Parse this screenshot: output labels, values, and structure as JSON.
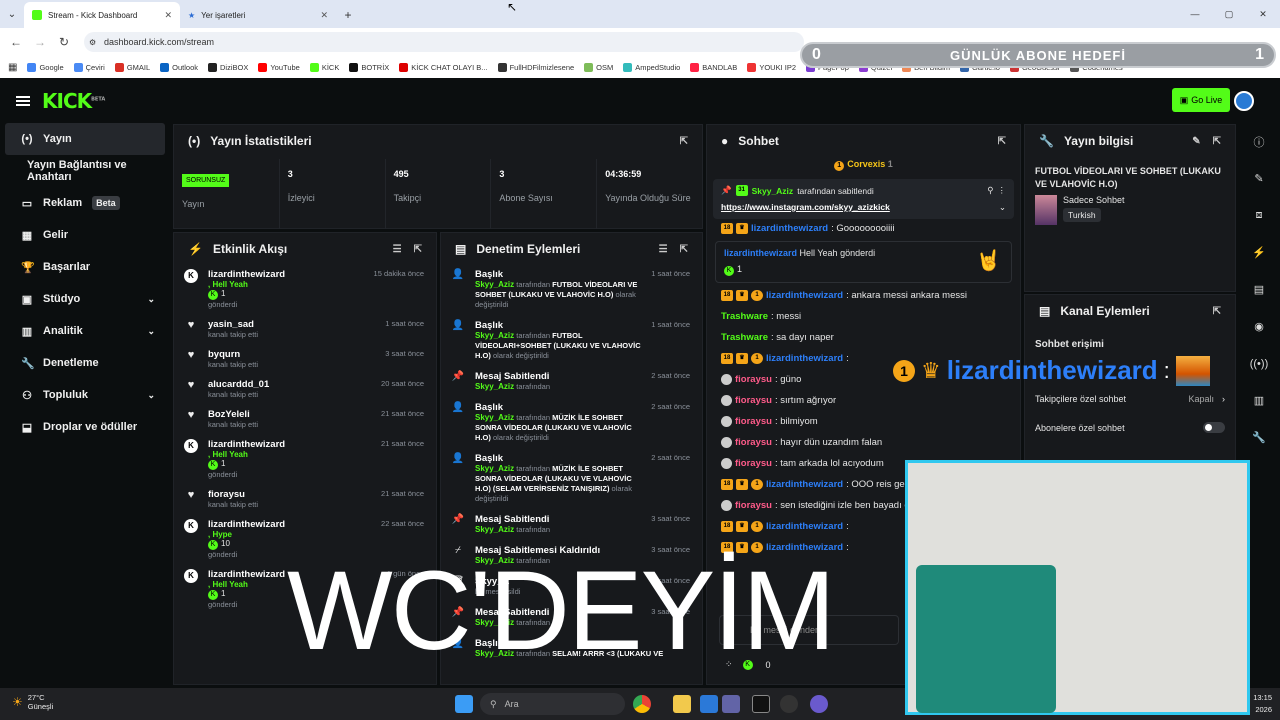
{
  "browser": {
    "tabs": [
      {
        "title": "Stream - Kick Dashboard",
        "active": true
      },
      {
        "title": "Yer işaretleri",
        "active": false
      }
    ],
    "url": "dashboard.kick.com/stream",
    "bookmarks": [
      "Google",
      "Çeviri",
      "GMAIL",
      "Outlook",
      "DiziBOX",
      "YouTube",
      "KİCK",
      "BOTRİX",
      "KİCK CHAT OLAYI B...",
      "FullHDFilmizlesene",
      "OSM",
      "AmpedStudio",
      "BANDLAB",
      "YOUKI IP2",
      "PagePop",
      "Quizei",
      "Ben Bildim",
      "Gartic.io",
      "GeoGuessr",
      "Codenames"
    ]
  },
  "goal": {
    "start": "0",
    "title": "GÜNLÜK ABONE HEDEFİ",
    "end": "1"
  },
  "header": {
    "logo": "KICK",
    "logo_sup": "BETA",
    "go_live": "Go Live"
  },
  "sidebar": {
    "items": [
      {
        "label": "Yayın",
        "icon": "broadcast-icon",
        "active": true
      },
      {
        "label": "Yayın Bağlantısı ve Anahtarı",
        "sub": true
      },
      {
        "label": "Reklam",
        "badge": "Beta",
        "icon": "ad-icon"
      },
      {
        "label": "Gelir",
        "icon": "revenue-icon"
      },
      {
        "label": "Başarılar",
        "icon": "trophy-icon"
      },
      {
        "label": "Stüdyo",
        "icon": "studio-icon",
        "chevron": true
      },
      {
        "label": "Analitik",
        "icon": "analytics-icon",
        "chevron": true
      },
      {
        "label": "Denetleme",
        "icon": "wrench-icon"
      },
      {
        "label": "Topluluk",
        "icon": "community-icon",
        "chevron": true
      },
      {
        "label": "Droplar ve ödüller",
        "icon": "drops-icon"
      }
    ]
  },
  "stats": {
    "title": "Yayın İstatistikleri",
    "status": "SORUNSUZ",
    "status_label": "Yayın",
    "items": [
      {
        "value": "3",
        "label": "İzleyici"
      },
      {
        "value": "495",
        "label": "Takipçi"
      },
      {
        "value": "3",
        "label": "Abone Sayısı"
      },
      {
        "value": "04:36:59",
        "label": "Yayında Olduğu Süre"
      }
    ]
  },
  "activity": {
    "title": "Etkinlik Akışı",
    "events": [
      {
        "user": "lizardinthewizard",
        "gift": ", Hell Yeah",
        "count": "1",
        "action": "gönderdi",
        "time": "15 dakika önce",
        "type": "kick"
      },
      {
        "user": "yasin_sad",
        "action": "kanalı takip etti",
        "time": "1 saat önce",
        "type": "follow"
      },
      {
        "user": "byqurn",
        "action": "kanalı takip etti",
        "time": "3 saat önce",
        "type": "follow"
      },
      {
        "user": "alucarddd_01",
        "action": "kanalı takip etti",
        "time": "20 saat önce",
        "type": "follow"
      },
      {
        "user": "BozYeleli",
        "action": "kanalı takip etti",
        "time": "21 saat önce",
        "type": "follow"
      },
      {
        "user": "lizardinthewizard",
        "gift": ", Hell Yeah",
        "count": "1",
        "action": "gönderdi",
        "time": "21 saat önce",
        "type": "kick"
      },
      {
        "user": "fioraysu",
        "action": "kanalı takip etti",
        "time": "21 saat önce",
        "type": "follow"
      },
      {
        "user": "lizardinthewizard",
        "gift": ", Hype",
        "count": "10",
        "action": "gönderdi",
        "time": "22 saat önce",
        "type": "kick"
      },
      {
        "user": "lizardinthewizard",
        "gift": ", Hell Yeah",
        "count": "1",
        "action": "gönderdi",
        "time": "1 gün önce",
        "type": "kick"
      }
    ]
  },
  "moderation": {
    "title": "Denetim Eylemleri",
    "items": [
      {
        "title": "Başlık",
        "user": "Skyy_Aziz",
        "pre": "tarafından",
        "detail": "FUTBOL VİDEOLARI VE SOHBET (LUKAKU VE VLAHOVİC H.O)",
        "post": "olarak değiştirildi",
        "time": "1 saat önce",
        "icon": "user-edit-icon"
      },
      {
        "title": "Başlık",
        "user": "Skyy_Aziz",
        "pre": "tarafından",
        "detail": "FUTBOL VİDEOLARI+SOHBET (LUKAKU VE VLAHOVİC H.O)",
        "post": "olarak değiştirildi",
        "time": "1 saat önce",
        "icon": "user-edit-icon"
      },
      {
        "title": "Mesaj Sabitlendi",
        "user": "Skyy_Aziz",
        "pre": "tarafından",
        "detail": "",
        "post": "",
        "time": "2 saat önce",
        "icon": "pin-icon"
      },
      {
        "title": "Başlık",
        "user": "Skyy_Aziz",
        "pre": "tarafından",
        "detail": "MÜZİK İLE SOHBET SONRA VİDEOLAR (LUKAKU VE VLAHOVİC H.O)",
        "post": "olarak değiştirildi",
        "time": "2 saat önce",
        "icon": "user-edit-icon"
      },
      {
        "title": "Başlık",
        "user": "Skyy_Aziz",
        "pre": "tarafından",
        "detail": "MÜZİK İLE SOHBET SONRA VİDEOLAR (LUKAKU VE VLAHOVİC H.O) (SELAM VERİRSENİZ TANIŞIRIZ)",
        "post": "olarak değiştirildi",
        "time": "2 saat önce",
        "icon": "user-edit-icon"
      },
      {
        "title": "Mesaj Sabitlendi",
        "user": "Skyy_Aziz",
        "pre": "tarafından",
        "detail": "",
        "post": "",
        "time": "3 saat önce",
        "icon": "pin-icon"
      },
      {
        "title": "Mesaj Sabitlemesi Kaldırıldı",
        "user": "Skyy_Aziz",
        "pre": "tarafından",
        "detail": "",
        "post": "",
        "time": "3 saat önce",
        "icon": "unpin-icon"
      },
      {
        "title": "Skyy_A",
        "user": "",
        "pre": "bir mesaj sildi",
        "detail": "",
        "post": "",
        "time": "3 saat önce",
        "icon": "trash-icon"
      },
      {
        "title": "Mesaj Sabitlendi",
        "user": "Skyy_Aziz",
        "pre": "tarafından",
        "detail": "",
        "post": "",
        "time": "3 saat önce",
        "icon": "pin-icon"
      },
      {
        "title": "Başlık",
        "user": "Skyy_Aziz",
        "pre": "tarafından",
        "detail": "SELAM! ARRR <3 (LUKAKU VE",
        "post": "",
        "time": "",
        "icon": "user-edit-icon"
      }
    ]
  },
  "chat": {
    "title": "Sohbet",
    "top_user": "Corvexis",
    "top_count": "1",
    "pinned": {
      "user": "Skyy_Aziz",
      "by": "tarafından sabitlendi",
      "link": "https://www.instagram.com/skyy_azizkick"
    },
    "partial": {
      "user": "lizardinthewizard",
      "text": ": Gooooooooiiii"
    },
    "gift": {
      "user": "lizardinthewizard",
      "text": "Hell Yeah",
      "suffix": "gönderdi",
      "count": "1"
    },
    "messages": [
      {
        "user": "lizardinthewizard",
        "color": "#2d7ff9",
        "text": ": ankara messi ankara messi",
        "badges": true
      },
      {
        "user": "Trashware",
        "color": "#53fc18",
        "text": ": messi"
      },
      {
        "user": "Trashware",
        "color": "#53fc18",
        "text": ": sa dayı naper"
      },
      {
        "user": "lizardinthewizard",
        "color": "#2d7ff9",
        "text": ":",
        "badges": true
      },
      {
        "user": "fioraysu",
        "color": "#ff5b8a",
        "text": ": güno",
        "dot": true
      },
      {
        "user": "fioraysu",
        "color": "#ff5b8a",
        "text": ": sırtım ağrıyor",
        "dot": true
      },
      {
        "user": "fioraysu",
        "color": "#ff5b8a",
        "text": ": bilmiyom",
        "dot": true
      },
      {
        "user": "fioraysu",
        "color": "#ff5b8a",
        "text": ": hayır dün uzandım falan",
        "dot": true
      },
      {
        "user": "fioraysu",
        "color": "#ff5b8a",
        "text": ": tam arkada lol acıyodum",
        "dot": true
      },
      {
        "user": "lizardinthewizard",
        "color": "#2d7ff9",
        "text": ": OOO reis ge",
        "badges": true
      },
      {
        "user": "fioraysu",
        "color": "#ff5b8a",
        "text": ": sen istediğini izle ben bayadı oynıyım",
        "dot": true
      },
      {
        "user": "lizardinthewizard",
        "color": "#2d7ff9",
        "text": ":",
        "badges": true
      },
      {
        "user": "lizardinthewizard",
        "color": "#2d7ff9",
        "text": ":",
        "badges": true
      }
    ],
    "placeholder": "Bir mesaj gönderin",
    "footer_count": "0"
  },
  "info": {
    "title": "Yayın bilgisi",
    "stream_title": "FUTBOL VİDEOLARI VE SOHBET (LUKAKU VE VLAHOVİC H.O)",
    "category": "Sadece Sohbet",
    "tag": "Turkish"
  },
  "channel_actions": {
    "title": "Kanal Eylemleri",
    "section": "Sohbet erişimi",
    "rows": [
      {
        "label": "Takipçilere özel sohbet",
        "value": "Kapalı"
      },
      {
        "label": "Abonelere özel sohbet",
        "value": ""
      }
    ]
  },
  "overlay": {
    "big_text": "WC'DEYİM",
    "badge_num": "1",
    "name": "lizardinthewizard",
    "colon": ":",
    "sub_count": "1 s"
  },
  "taskbar": {
    "temp": "27°C",
    "weather": "Güneşli",
    "search": "Ara",
    "time": "13:15",
    "date": "2026"
  }
}
